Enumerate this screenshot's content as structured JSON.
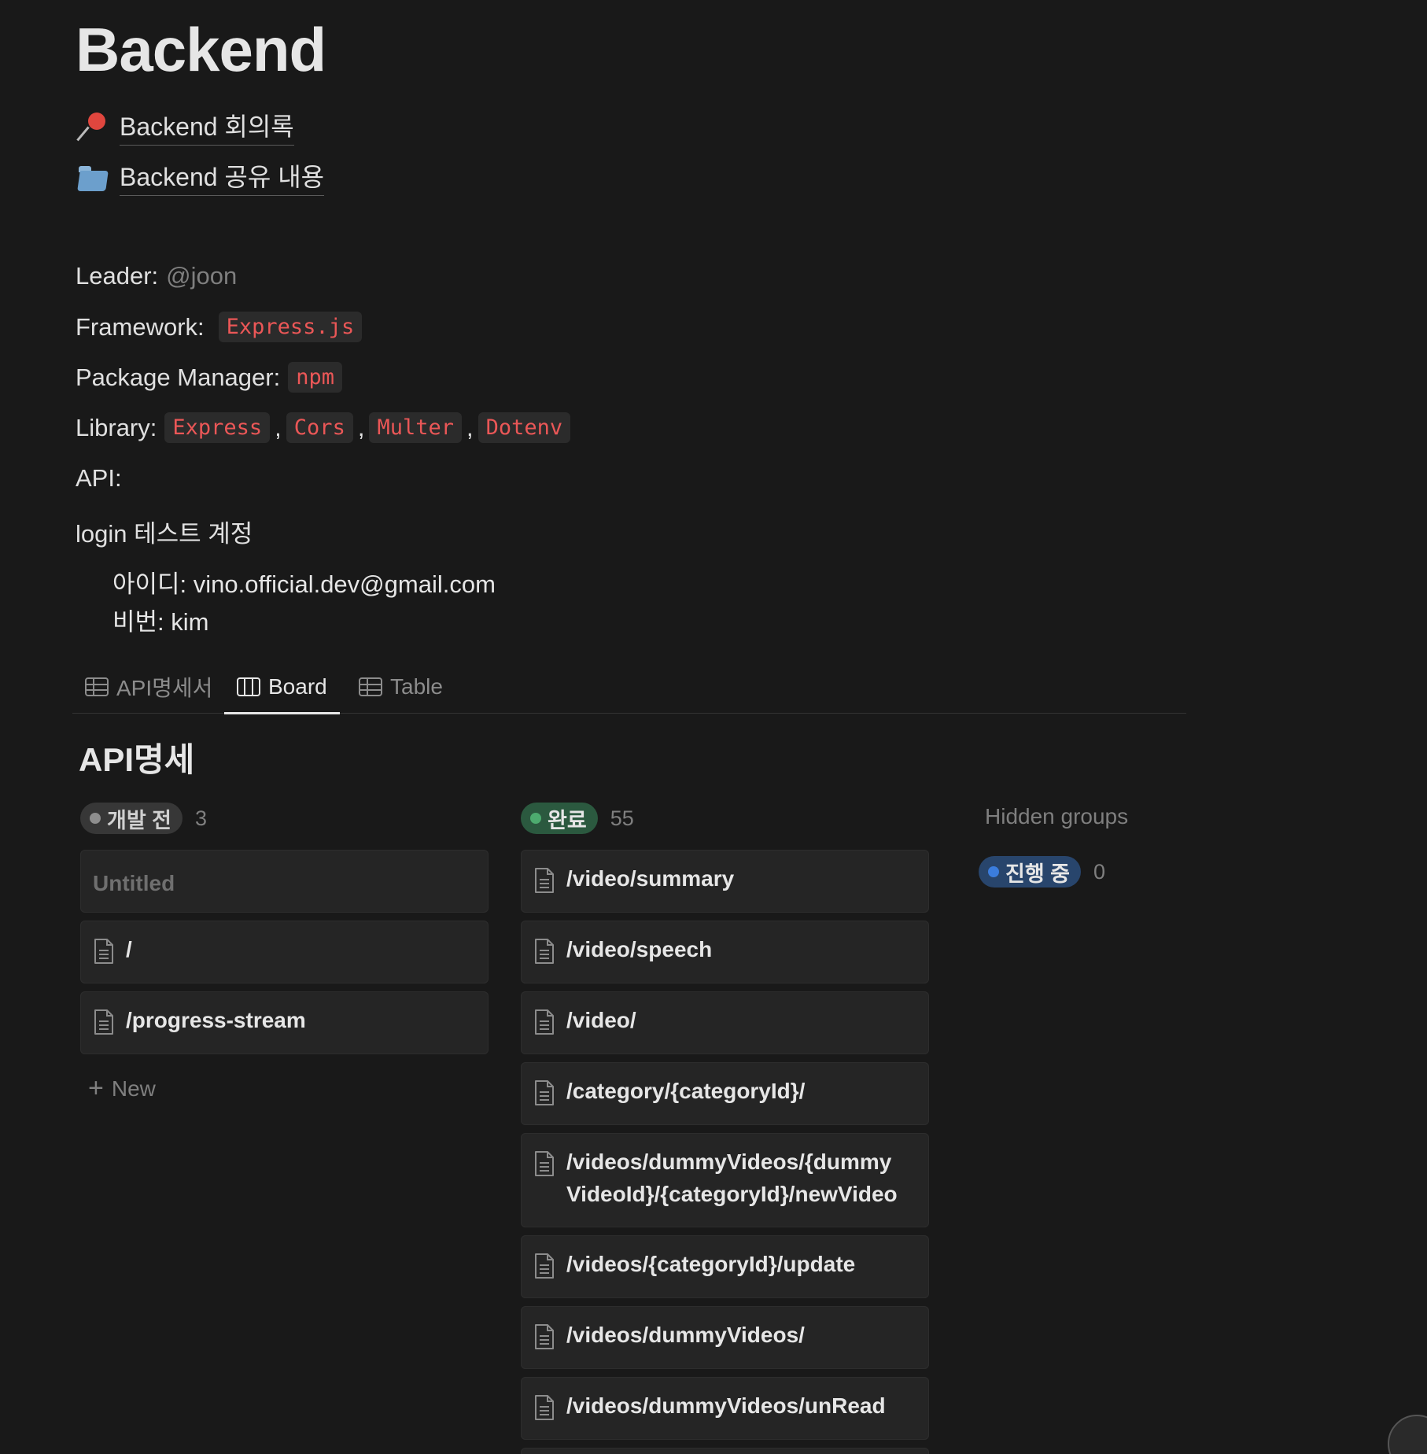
{
  "page": {
    "title": "Backend",
    "links": [
      {
        "icon": "pushpin-icon",
        "label": "Backend 회의록"
      },
      {
        "icon": "folder-icon",
        "label": "Backend 공유 내용"
      }
    ]
  },
  "properties": {
    "leader_label": "Leader:",
    "leader_value": "@joon",
    "framework_label": "Framework:",
    "framework_value": "Express.js",
    "package_manager_label": "Package Manager:",
    "package_manager_value": "npm",
    "library_label": "Library:",
    "libraries": [
      "Express",
      "Cors",
      "Multer",
      "Dotenv"
    ],
    "library_separator": ",",
    "api_label": "API:",
    "login_label": "login 테스트 계정",
    "id_line": "아이디: vino.official.dev@gmail.com",
    "pw_line": "비번: kim"
  },
  "tabs": [
    {
      "label": "API명세서",
      "icon": "table-icon",
      "active": false
    },
    {
      "label": "Board",
      "icon": "board-icon",
      "active": true
    },
    {
      "label": "Table",
      "icon": "table-icon",
      "active": false
    }
  ],
  "board": {
    "title": "API명세",
    "groups": [
      {
        "name": "개발 전",
        "count": "3",
        "badge_bg": "#373737",
        "dot_color": "#8e8e8e",
        "cards": [
          "Untitled",
          "/",
          "/progress-stream"
        ],
        "new_label": "New"
      },
      {
        "name": "완료",
        "count": "55",
        "badge_bg": "#2b593f",
        "dot_color": "#4dab6f",
        "cards": [
          "/video/summary",
          "/video/speech",
          "/video/",
          "/category/{categoryId}/",
          "/videos/dummyVideos/{dummyVideoId}/{categoryId}/newVideo",
          "/videos/{categoryId}/update",
          "/videos/dummyVideos/",
          "/videos/dummyVideos/unRead"
        ]
      }
    ],
    "hidden_groups_label": "Hidden groups",
    "hidden_groups": [
      {
        "name": "진행 중",
        "count": "0",
        "badge_bg": "#28456c",
        "dot_color": "#3b7ddd"
      }
    ]
  },
  "colors": {
    "background": "#191919",
    "code_text": "#eb5757",
    "code_bg": "#2b2b2b"
  }
}
